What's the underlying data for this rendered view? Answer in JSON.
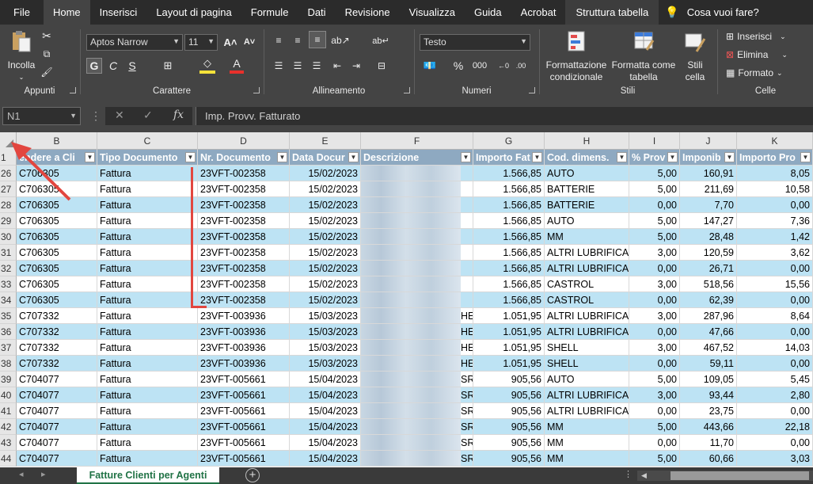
{
  "ribbon_tabs": [
    "File",
    "Home",
    "Inserisci",
    "Layout di pagina",
    "Formule",
    "Dati",
    "Revisione",
    "Visualizza",
    "Guida",
    "Acrobat",
    "Struttura tabella"
  ],
  "tell_me": "Cosa vuoi fare?",
  "ribbon": {
    "paste_label": "Incolla",
    "group_appunti": "Appunti",
    "font_name": "Aptos Narrow",
    "font_size": "11",
    "group_carattere": "Carattere",
    "group_allineamento": "Allineamento",
    "number_format": "Testo",
    "group_numeri": "Numeri",
    "cond_format": "Formattazione condizionale",
    "format_table": "Formatta come tabella",
    "cell_styles": "Stili cella",
    "group_stili": "Stili",
    "insert": "Inserisci",
    "delete": "Elimina",
    "format": "Formato",
    "group_celle": "Celle"
  },
  "name_box": "N1",
  "formula": "Imp. Provv. Fatturato",
  "columns": [
    "B",
    "C",
    "D",
    "E",
    "F",
    "G",
    "H",
    "I",
    "J",
    "K"
  ],
  "headers": [
    "endere a Cli",
    "Tipo Documento",
    "Nr. Documento",
    "Data Docur",
    "Descrizione",
    "Importo Fat",
    "Cod. dimens.",
    "% Prov",
    "Imponib",
    "Importo Pro"
  ],
  "rows": [
    {
      "n": "1",
      "cells": []
    },
    {
      "n": "26",
      "cells": [
        "C706305",
        "Fattura",
        "23VFT-002358",
        "15/02/2023",
        "",
        "1.566,85",
        "AUTO",
        "5,00",
        "160,91",
        "8,05"
      ]
    },
    {
      "n": "27",
      "cells": [
        "C706305",
        "Fattura",
        "23VFT-002358",
        "15/02/2023",
        "",
        "1.566,85",
        "BATTERIE",
        "5,00",
        "211,69",
        "10,58"
      ]
    },
    {
      "n": "28",
      "cells": [
        "C706305",
        "Fattura",
        "23VFT-002358",
        "15/02/2023",
        "",
        "1.566,85",
        "BATTERIE",
        "0,00",
        "7,70",
        "0,00"
      ]
    },
    {
      "n": "29",
      "cells": [
        "C706305",
        "Fattura",
        "23VFT-002358",
        "15/02/2023",
        "",
        "1.566,85",
        "AUTO",
        "5,00",
        "147,27",
        "7,36"
      ]
    },
    {
      "n": "30",
      "cells": [
        "C706305",
        "Fattura",
        "23VFT-002358",
        "15/02/2023",
        "",
        "1.566,85",
        "MM",
        "5,00",
        "28,48",
        "1,42"
      ]
    },
    {
      "n": "31",
      "cells": [
        "C706305",
        "Fattura",
        "23VFT-002358",
        "15/02/2023",
        "",
        "1.566,85",
        "ALTRI LUBRIFICAN",
        "3,00",
        "120,59",
        "3,62"
      ]
    },
    {
      "n": "32",
      "cells": [
        "C706305",
        "Fattura",
        "23VFT-002358",
        "15/02/2023",
        "",
        "1.566,85",
        "ALTRI LUBRIFICAN",
        "0,00",
        "26,71",
        "0,00"
      ]
    },
    {
      "n": "33",
      "cells": [
        "C706305",
        "Fattura",
        "23VFT-002358",
        "15/02/2023",
        "",
        "1.566,85",
        "CASTROL",
        "3,00",
        "518,56",
        "15,56"
      ]
    },
    {
      "n": "34",
      "cells": [
        "C706305",
        "Fattura",
        "23VFT-002358",
        "15/02/2023",
        "",
        "1.566,85",
        "CASTROL",
        "0,00",
        "62,39",
        "0,00"
      ]
    },
    {
      "n": "35",
      "cells": [
        "C707332",
        "Fattura",
        "23VFT-003936",
        "15/03/2023",
        "HE",
        "1.051,95",
        "ALTRI LUBRIFICAN",
        "3,00",
        "287,96",
        "8,64"
      ]
    },
    {
      "n": "36",
      "cells": [
        "C707332",
        "Fattura",
        "23VFT-003936",
        "15/03/2023",
        "HE",
        "1.051,95",
        "ALTRI LUBRIFICAN",
        "0,00",
        "47,66",
        "0,00"
      ]
    },
    {
      "n": "37",
      "cells": [
        "C707332",
        "Fattura",
        "23VFT-003936",
        "15/03/2023",
        "HE",
        "1.051,95",
        "SHELL",
        "3,00",
        "467,52",
        "14,03"
      ]
    },
    {
      "n": "38",
      "cells": [
        "C707332",
        "Fattura",
        "23VFT-003936",
        "15/03/2023",
        "HE",
        "1.051,95",
        "SHELL",
        "0,00",
        "59,11",
        "0,00"
      ]
    },
    {
      "n": "39",
      "cells": [
        "C704077",
        "Fattura",
        "23VFT-005661",
        "15/04/2023",
        "SR",
        "905,56",
        "AUTO",
        "5,00",
        "109,05",
        "5,45"
      ]
    },
    {
      "n": "40",
      "cells": [
        "C704077",
        "Fattura",
        "23VFT-005661",
        "15/04/2023",
        "SR",
        "905,56",
        "ALTRI LUBRIFICAN",
        "3,00",
        "93,44",
        "2,80"
      ]
    },
    {
      "n": "41",
      "cells": [
        "C704077",
        "Fattura",
        "23VFT-005661",
        "15/04/2023",
        "SR",
        "905,56",
        "ALTRI LUBRIFICAN",
        "0,00",
        "23,75",
        "0,00"
      ]
    },
    {
      "n": "42",
      "cells": [
        "C704077",
        "Fattura",
        "23VFT-005661",
        "15/04/2023",
        "SR",
        "905,56",
        "MM",
        "5,00",
        "443,66",
        "22,18"
      ]
    },
    {
      "n": "43",
      "cells": [
        "C704077",
        "Fattura",
        "23VFT-005661",
        "15/04/2023",
        "SR",
        "905,56",
        "MM",
        "0,00",
        "11,70",
        "0,00"
      ]
    },
    {
      "n": "44",
      "cells": [
        "C704077",
        "Fattura",
        "23VFT-005661",
        "15/04/2023",
        "SR",
        "905,56",
        "MM",
        "5,00",
        "60,66",
        "3,03"
      ]
    }
  ],
  "sheet_tab": "Fatture Clienti per Agenti",
  "colors": {
    "band": "#bde3f4",
    "header": "#8ea9c1",
    "annotation": "#e2463f"
  }
}
